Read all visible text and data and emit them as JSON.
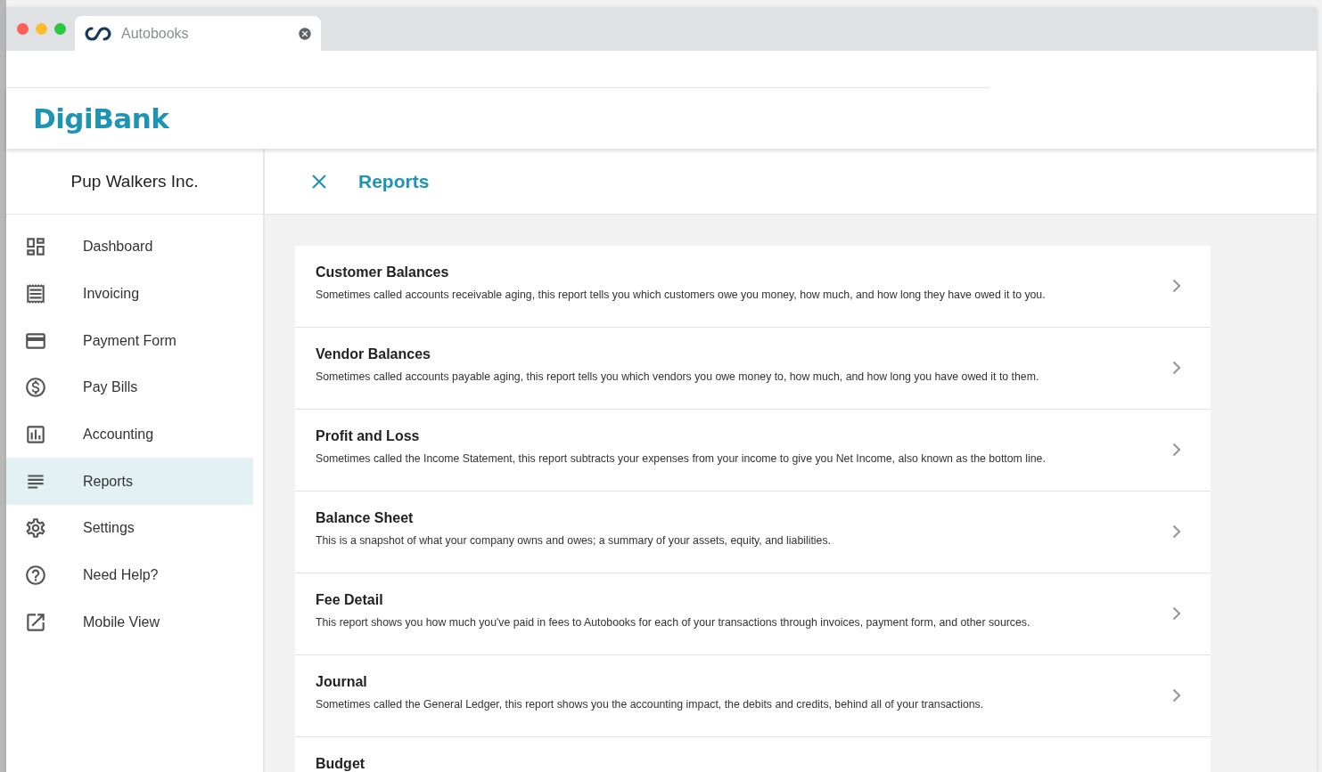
{
  "browser_tab": {
    "title": "Autobooks"
  },
  "logo": "DigiBank",
  "company": "Pup Walkers Inc.",
  "nav": [
    {
      "label": "Dashboard",
      "selected": false
    },
    {
      "label": "Invoicing",
      "selected": false
    },
    {
      "label": "Payment Form",
      "selected": false
    },
    {
      "label": "Pay Bills",
      "selected": false
    },
    {
      "label": "Accounting",
      "selected": false
    },
    {
      "label": "Reports",
      "selected": true
    },
    {
      "label": "Settings",
      "selected": false
    },
    {
      "label": "Need Help?",
      "selected": false
    },
    {
      "label": "Mobile View",
      "selected": false
    }
  ],
  "page_title": "Reports",
  "reports": [
    {
      "title": "Customer Balances",
      "description": "Sometimes called accounts receivable aging, this report tells you which customers owe you money, how much, and how long they have owed it to you."
    },
    {
      "title": "Vendor Balances",
      "description": "Sometimes called accounts payable aging, this report tells you which vendors you owe money to, how much, and how long you have owed it to them."
    },
    {
      "title": "Profit and Loss",
      "description": "Sometimes called the Income Statement, this report subtracts your expenses from your income to give you Net Income, also known as the bottom line."
    },
    {
      "title": "Balance Sheet",
      "description": "This is a snapshot of what your company owns and owes; a summary of your assets, equity, and liabilities."
    },
    {
      "title": "Fee Detail",
      "description": "This report shows you how much you've paid in fees to Autobooks for each of your transactions through invoices, payment form, and other sources."
    },
    {
      "title": "Journal",
      "description": "Sometimes called the General Ledger, this report shows you the accounting impact, the debits and credits, behind all of your transactions."
    },
    {
      "title": "Budget"
    }
  ]
}
